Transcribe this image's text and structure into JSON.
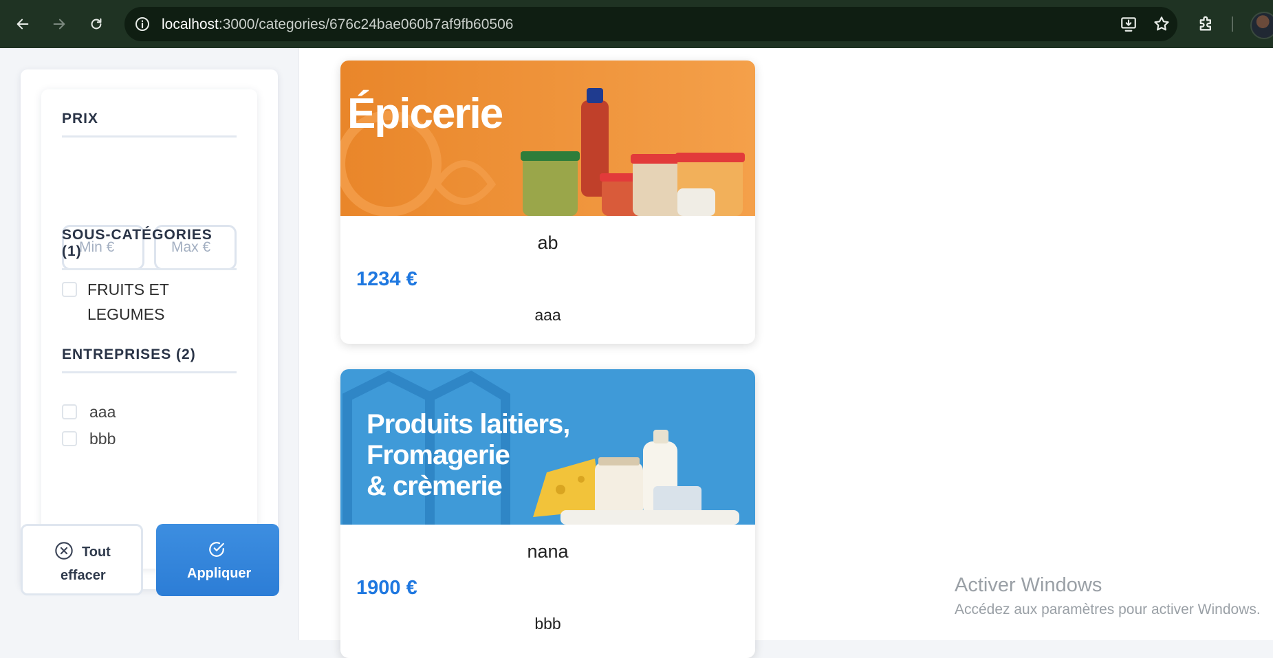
{
  "browser": {
    "url_host": "localhost",
    "url_path": ":3000/categories/676c24bae060b7af9fb60506"
  },
  "filters": {
    "price_title": "PRIX",
    "min_placeholder": "Min €",
    "max_placeholder": "Max €",
    "subcategories_title": "SOUS-CATÉGORIES (1)",
    "subcategories": [
      {
        "label_line1": "FRUITS ET",
        "label_line2": "LEGUMES",
        "checked": false
      }
    ],
    "companies_title": "ENTREPRISES (2)",
    "companies": [
      {
        "label": "aaa",
        "checked": false
      },
      {
        "label": "bbb",
        "checked": false
      }
    ],
    "clear_label_line1": "Tout",
    "clear_label_line2": "effacer",
    "apply_label": "Appliquer"
  },
  "products": [
    {
      "banner_text": "Épicerie",
      "banner_color": "#ec8a2c",
      "name": "ab",
      "price": "1234 €",
      "company": "aaa"
    },
    {
      "banner_text_line1": "Produits laitiers,",
      "banner_text_line2": "Fromagerie",
      "banner_text_line3": "& crèmerie",
      "banner_color": "#3f9ad8",
      "name": "nana",
      "price": "1900 €",
      "company": "bbb"
    }
  ],
  "watermark": {
    "title": "Activer Windows",
    "subtitle": "Accédez aux paramètres pour activer Windows."
  },
  "colors": {
    "accent": "#1f78e0",
    "apply_button": "#3589dc",
    "browser_frame": "#1f3323"
  }
}
